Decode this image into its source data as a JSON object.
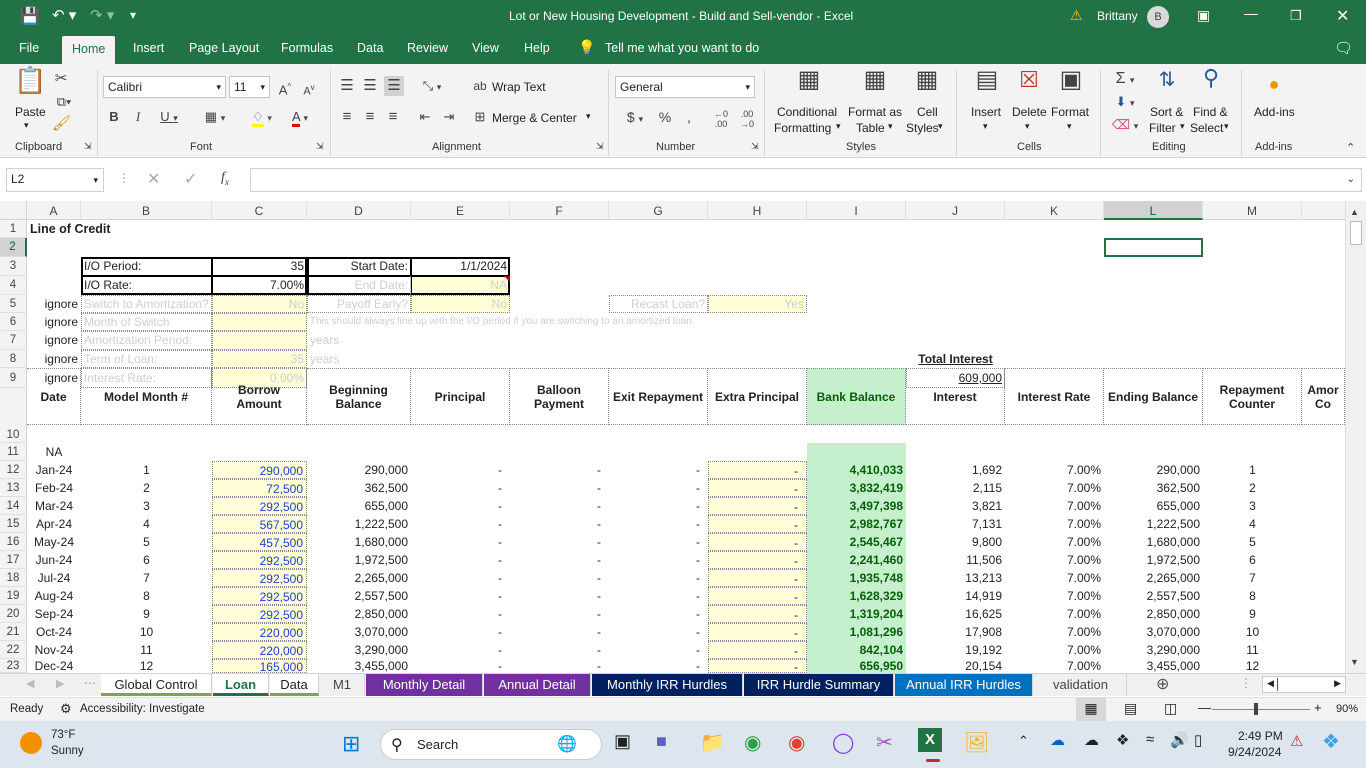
{
  "window": {
    "title": "Lot or New Housing Development - Build and Sell-vendor  -  Excel",
    "user": "Brittany",
    "user_initial": "B",
    "warning_icon": "warning-icon"
  },
  "menu": [
    "File",
    "Home",
    "Insert",
    "Page Layout",
    "Formulas",
    "Data",
    "Review",
    "View",
    "Help"
  ],
  "tell_me": "Tell me what you want to do",
  "ribbon": {
    "paste": "Paste",
    "clipboard": "Clipboard",
    "font_name": "Calibri",
    "font_size": "11",
    "font": "Font",
    "wrap_text": "Wrap Text",
    "merge_center": "Merge & Center",
    "alignment": "Alignment",
    "number_format": "General",
    "number": "Number",
    "conditional": "Conditional",
    "formatting": "Formatting",
    "format_as": "Format as",
    "table": "Table",
    "cell": "Cell",
    "styles_btn": "Styles",
    "styles": "Styles",
    "insert": "Insert",
    "delete": "Delete",
    "format": "Format",
    "cells": "Cells",
    "sort": "Sort &",
    "filter": "Filter",
    "find": "Find &",
    "select": "Select",
    "editing": "Editing",
    "addins_btn": "Add-ins",
    "addins": "Add-ins"
  },
  "name_box": "L2",
  "columns": [
    "A",
    "B",
    "C",
    "D",
    "E",
    "F",
    "G",
    "H",
    "I",
    "J",
    "K",
    "L",
    "M"
  ],
  "rows": [
    "1",
    "2",
    "3",
    "4",
    "5",
    "6",
    "7",
    "8",
    "9",
    "10",
    "11",
    "12",
    "13",
    "14",
    "15",
    "16",
    "17",
    "18",
    "19",
    "20",
    "21",
    "22",
    "23"
  ],
  "top": {
    "title": "Line of Credit",
    "io_period_label": "I/O Period:",
    "io_period": "35",
    "start_date_label": "Start Date:",
    "start_date": "1/1/2024",
    "io_rate_label": "I/O Rate:",
    "io_rate": "7.00%",
    "end_date_label": "End Date:",
    "end_date": "NA",
    "ignore": "ignore",
    "switch_label": "Switch to Amortization?",
    "switch_val": "No",
    "payoff_label": "Payoff Early?",
    "payoff_val": "No",
    "recast_label": "Recast Loan?",
    "recast_val": "Yes",
    "month_switch_label": "Month of Switch",
    "note": "This should always line up with the I/O period if you are switching to an amortized loan.",
    "amort_label": "Amortization Period:",
    "years": "years",
    "term_label": "Term of Loan:",
    "term_val": "35",
    "rate_label": "Interest Rate:",
    "rate_val": "0.00%",
    "total_interest_label": "Total Interest",
    "total_interest": "609,000"
  },
  "headers": [
    "Date",
    "Model Month #",
    "Borrow Amount",
    "Beginning Balance",
    "Principal",
    "Balloon Payment",
    "Exit Repayment",
    "Extra Principal",
    "Bank Balance",
    "Interest",
    "Interest Rate",
    "Ending Balance",
    "Repayment Counter",
    "Amor Co"
  ],
  "row11_date": "NA",
  "table": [
    [
      "Jan-24",
      "1",
      "290,000",
      "290,000",
      "-",
      "-",
      "-",
      "-",
      "4,410,033",
      "1,692",
      "7.00%",
      "290,000",
      "1"
    ],
    [
      "Feb-24",
      "2",
      "72,500",
      "362,500",
      "-",
      "-",
      "-",
      "-",
      "3,832,419",
      "2,115",
      "7.00%",
      "362,500",
      "2"
    ],
    [
      "Mar-24",
      "3",
      "292,500",
      "655,000",
      "-",
      "-",
      "-",
      "-",
      "3,497,398",
      "3,821",
      "7.00%",
      "655,000",
      "3"
    ],
    [
      "Apr-24",
      "4",
      "567,500",
      "1,222,500",
      "-",
      "-",
      "-",
      "-",
      "2,982,767",
      "7,131",
      "7.00%",
      "1,222,500",
      "4"
    ],
    [
      "May-24",
      "5",
      "457,500",
      "1,680,000",
      "-",
      "-",
      "-",
      "-",
      "2,545,467",
      "9,800",
      "7.00%",
      "1,680,000",
      "5"
    ],
    [
      "Jun-24",
      "6",
      "292,500",
      "1,972,500",
      "-",
      "-",
      "-",
      "-",
      "2,241,460",
      "11,506",
      "7.00%",
      "1,972,500",
      "6"
    ],
    [
      "Jul-24",
      "7",
      "292,500",
      "2,265,000",
      "-",
      "-",
      "-",
      "-",
      "1,935,748",
      "13,213",
      "7.00%",
      "2,265,000",
      "7"
    ],
    [
      "Aug-24",
      "8",
      "292,500",
      "2,557,500",
      "-",
      "-",
      "-",
      "-",
      "1,628,329",
      "14,919",
      "7.00%",
      "2,557,500",
      "8"
    ],
    [
      "Sep-24",
      "9",
      "292,500",
      "2,850,000",
      "-",
      "-",
      "-",
      "-",
      "1,319,204",
      "16,625",
      "7.00%",
      "2,850,000",
      "9"
    ],
    [
      "Oct-24",
      "10",
      "220,000",
      "3,070,000",
      "-",
      "-",
      "-",
      "-",
      "1,081,296",
      "17,908",
      "7.00%",
      "3,070,000",
      "10"
    ],
    [
      "Nov-24",
      "11",
      "220,000",
      "3,290,000",
      "-",
      "-",
      "-",
      "-",
      "842,104",
      "19,192",
      "7.00%",
      "3,290,000",
      "11"
    ],
    [
      "Dec-24",
      "12",
      "165,000",
      "3,455,000",
      "-",
      "-",
      "-",
      "-",
      "656,950",
      "20,154",
      "7.00%",
      "3,455,000",
      "12"
    ]
  ],
  "tabs": [
    {
      "label": "Global Control",
      "bg": "#ffffff",
      "fg": "#222",
      "underline": "#70ad47"
    },
    {
      "label": "Loan",
      "bg": "#ffffff",
      "fg": "#217346",
      "underline": "#217346",
      "active": true
    },
    {
      "label": "Data",
      "bg": "#ffffff",
      "fg": "#222",
      "underline": "#70ad47"
    },
    {
      "label": "M1",
      "bg": "#f0f0f0",
      "fg": "#444",
      "underline": ""
    },
    {
      "label": "Monthly Detail",
      "bg": "#7030a0",
      "fg": "#ffffff",
      "underline": ""
    },
    {
      "label": "Annual Detail",
      "bg": "#7030a0",
      "fg": "#ffffff",
      "underline": ""
    },
    {
      "label": "Monthly IRR Hurdles",
      "bg": "#002060",
      "fg": "#ffffff",
      "underline": ""
    },
    {
      "label": "IRR Hurdle Summary",
      "bg": "#002060",
      "fg": "#ffffff",
      "underline": ""
    },
    {
      "label": "Annual IRR Hurdles",
      "bg": "#0070c0",
      "fg": "#ffffff",
      "underline": ""
    },
    {
      "label": "validation",
      "bg": "#f0f0f0",
      "fg": "#444",
      "underline": ""
    }
  ],
  "status": {
    "ready": "Ready",
    "accessibility": "Accessibility: Investigate",
    "zoom": "90%"
  },
  "taskbar": {
    "temp": "73°F",
    "weather": "Sunny",
    "search": "Search",
    "time": "2:49 PM",
    "date": "9/24/2024"
  }
}
